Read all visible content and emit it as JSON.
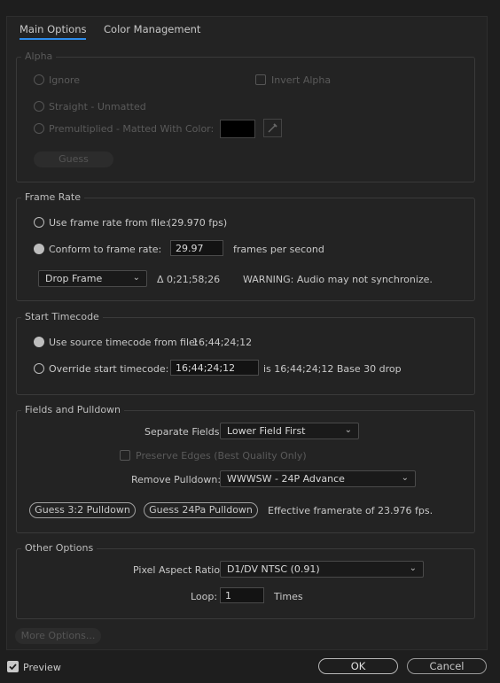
{
  "tabs": {
    "main": "Main Options",
    "color": "Color Management"
  },
  "alpha": {
    "title": "Alpha",
    "ignore": "Ignore",
    "invert": "Invert Alpha",
    "straight": "Straight - Unmatted",
    "premultiplied": "Premultiplied - Matted With Color:",
    "guess": "Guess"
  },
  "frame_rate": {
    "title": "Frame Rate",
    "use_file": "Use frame rate from file:",
    "file_fps": "(29.970 fps)",
    "conform": "Conform to frame rate:",
    "conform_value": "29.97",
    "fps_unit": "frames per second",
    "drop_frame": "Drop Frame",
    "duration": "Δ 0;21;58;26",
    "warning": "WARNING: Audio may not synchronize."
  },
  "start_timecode": {
    "title": "Start Timecode",
    "use_source": "Use source timecode from file:",
    "source_value": "16;44;24;12",
    "override": "Override start timecode:",
    "override_value": "16;44;24;12",
    "info": "is 16;44;24;12  Base 30  drop"
  },
  "fields": {
    "title": "Fields and Pulldown",
    "separate_label": "Separate Fields:",
    "separate_value": "Lower Field First",
    "preserve": "Preserve Edges (Best Quality Only)",
    "remove_label": "Remove Pulldown:",
    "remove_value": "WWWSW - 24P Advance",
    "guess32": "Guess 3:2 Pulldown",
    "guess24": "Guess 24Pa Pulldown",
    "effective": "Effective framerate of 23.976 fps."
  },
  "other": {
    "title": "Other Options",
    "par_label": "Pixel Aspect Ratio:",
    "par_value": "D1/DV NTSC (0.91)",
    "loop_label": "Loop:",
    "loop_value": "1",
    "times": "Times"
  },
  "more_options": "More Options...",
  "footer": {
    "preview": "Preview",
    "ok": "OK",
    "cancel": "Cancel"
  },
  "colors": {
    "accent": "#2d8ceb",
    "background": "#232323",
    "disabled": "#5a5a5a"
  }
}
